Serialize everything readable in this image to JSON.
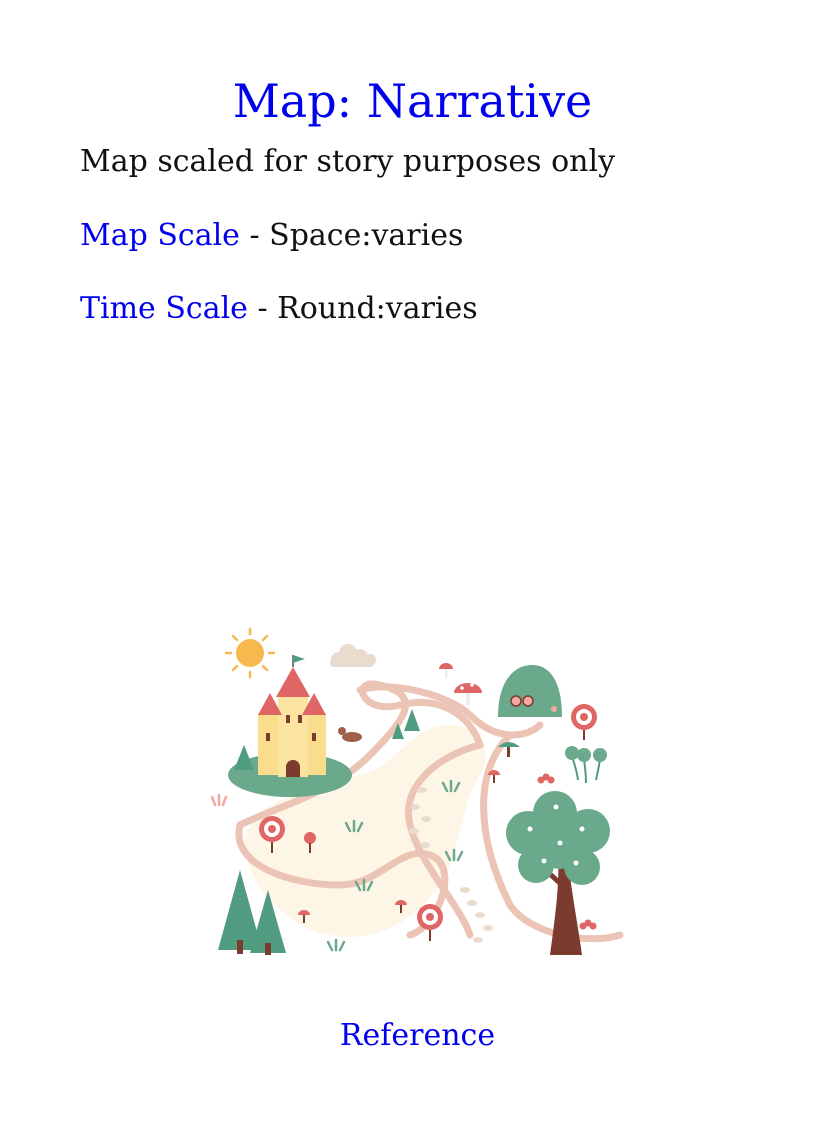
{
  "title": "Map: Narrative",
  "subtitle": "Map scaled for story purposes only",
  "map_scale": {
    "label": "Map Scale",
    "separator": " - ",
    "value": "Space:varies"
  },
  "time_scale": {
    "label": "Time Scale",
    "separator": " - ",
    "value": "Round:varies"
  },
  "reference_link": "Reference",
  "colors": {
    "link": "#0000ee",
    "text": "#111111"
  }
}
